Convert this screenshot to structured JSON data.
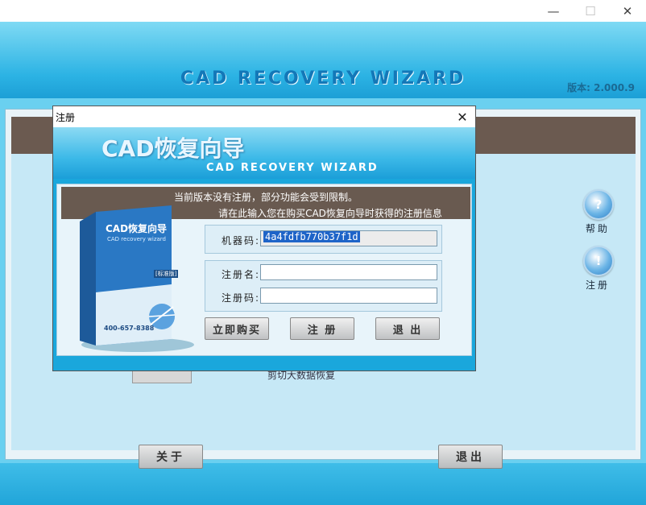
{
  "os_window": {
    "minimize_glyph": "—",
    "maximize_glyph": "☐",
    "close_glyph": "✕"
  },
  "app": {
    "title": "CAD RECOVERY WIZARD",
    "version": "版本: 2.000.9",
    "obscured_text": "剪切大数据恢复",
    "side_buttons": [
      {
        "label": "帮助",
        "icon": "help-icon",
        "glyph": "?"
      },
      {
        "label": "注册",
        "icon": "register-icon",
        "glyph": "!"
      }
    ],
    "bottom_buttons": {
      "about": "关于",
      "exit": "退出"
    }
  },
  "dialog": {
    "title": "注册",
    "close_glyph": "✕",
    "banner_cn": "CAD恢复向导",
    "banner_en": "CAD RECOVERY WIZARD",
    "notice_line1": "当前版本没有注册，部分功能会受到限制。",
    "notice_line2": "请在此输入您在购买CAD恢复向导时获得的注册信息",
    "product_box": {
      "name": "CAD恢复向导",
      "subtitle": "CAD recovery wizard",
      "edition": "[标准版]",
      "phone": "400-657-8388"
    },
    "machine_code_label": "机器码:",
    "machine_code_value": "4a4fdfb770b37f1d",
    "reg_name_label": "注册名:",
    "reg_name_value": "",
    "reg_code_label": "注册码:",
    "reg_code_value": "",
    "buttons": {
      "buy": "立即购买",
      "register": "注 册",
      "exit": "退 出"
    }
  },
  "colors": {
    "app_background": "#6ad0f0",
    "dialog_background": "#1aa7dc",
    "notice_bar": "#695a50",
    "selection_highlight": "#1e64c8"
  }
}
